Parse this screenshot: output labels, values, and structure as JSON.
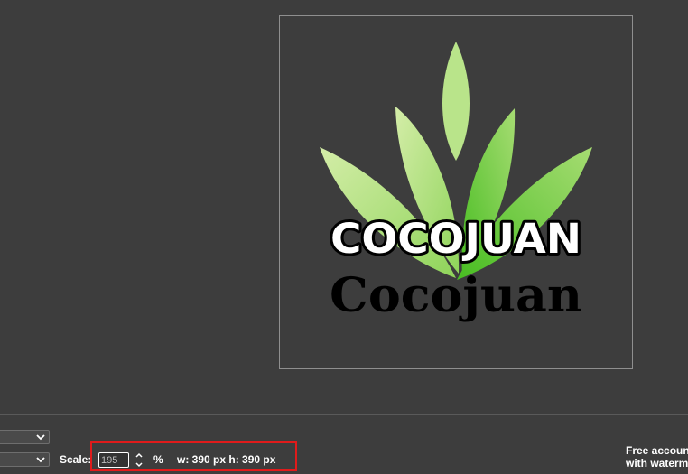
{
  "canvas": {
    "logo_title": "COCOJUAN",
    "logo_subtitle": "Cocojuan",
    "leaf_icon": "leaf-cluster-icon",
    "colors": {
      "leaf_light": "#c8e89a",
      "leaf_mid": "#9fd86a",
      "leaf_dark": "#52c22a",
      "frame_border": "#8f8f8f"
    }
  },
  "toolbar": {
    "scale_label": "Scale:",
    "scale_value": "195",
    "percent_sign": "%",
    "dimensions": "w: 390 px h: 390 px",
    "free_note_line1": "Free account",
    "free_note_line2": "with watermark",
    "highlight_color": "#e01b1b"
  }
}
